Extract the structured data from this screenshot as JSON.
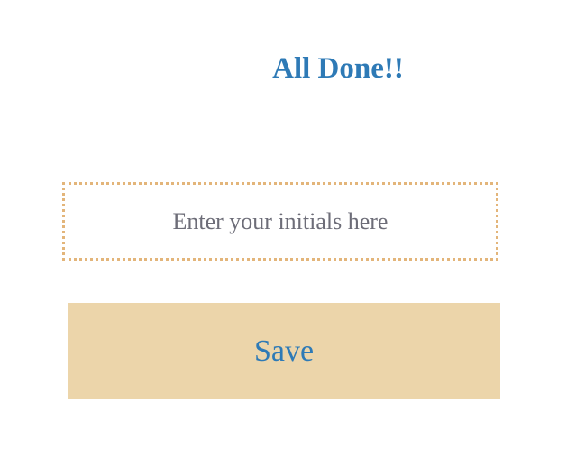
{
  "title": "All Done!!",
  "initials_input": {
    "value": "",
    "placeholder": "Enter your initials here"
  },
  "save_label": "Save",
  "colors": {
    "accent": "#2e7ab6",
    "button_bg": "#ecd5aa",
    "border": "#e3b57a"
  }
}
